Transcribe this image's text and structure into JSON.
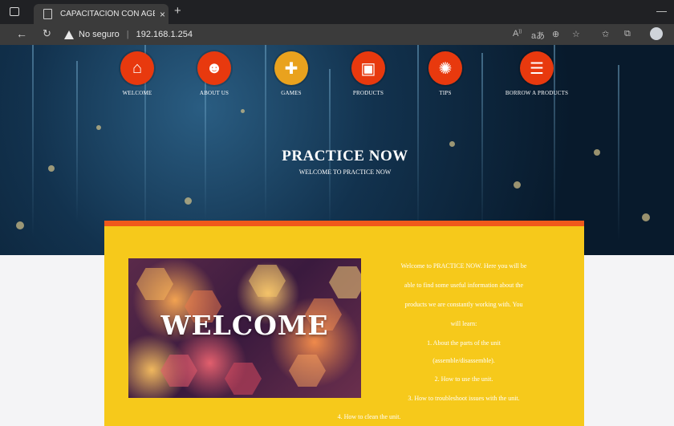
{
  "browser": {
    "tab_title": "CAPACITACIÓN CON AGENTES D",
    "tab_close": "×",
    "new_tab": "+",
    "security_label": "No seguro",
    "url": "192.168.1.254",
    "window_min": "—"
  },
  "site": {
    "nav": [
      {
        "label": "WELCOME",
        "icon": "home-icon",
        "glyph": "⌂"
      },
      {
        "label": "ABOUT US",
        "icon": "people-icon",
        "glyph": "👥"
      },
      {
        "label": "GAMES",
        "icon": "puzzle-icon",
        "glyph": "✚"
      },
      {
        "label": "PRODUCTS",
        "icon": "box-icon",
        "glyph": "▣"
      },
      {
        "label": "TIPS",
        "icon": "lightbulb-icon",
        "glyph": "✺"
      },
      {
        "label": "BORROW A PRODUCTS",
        "icon": "list-icon",
        "glyph": "☰"
      }
    ],
    "hero_title": "PRACTICE NOW",
    "hero_subtitle": "WELCOME TO PRACTICE NOW",
    "welcome_image_text": "WELCOME",
    "intro_lines": [
      "Welcome to PRACTICE NOW. Here you will be",
      "able to find some useful information about the",
      "products we are constantly working with. You",
      "will learn:",
      "1. About the parts of the unit",
      "(assemble/disassemble).",
      "2. How to use the unit.",
      "3. How to troubleshoot issues with the unit.",
      "4. How to clean the unit."
    ]
  },
  "colors": {
    "accent_orange": "#e8390e",
    "panel_yellow": "#f6c91b",
    "panel_border": "#f0591b"
  }
}
